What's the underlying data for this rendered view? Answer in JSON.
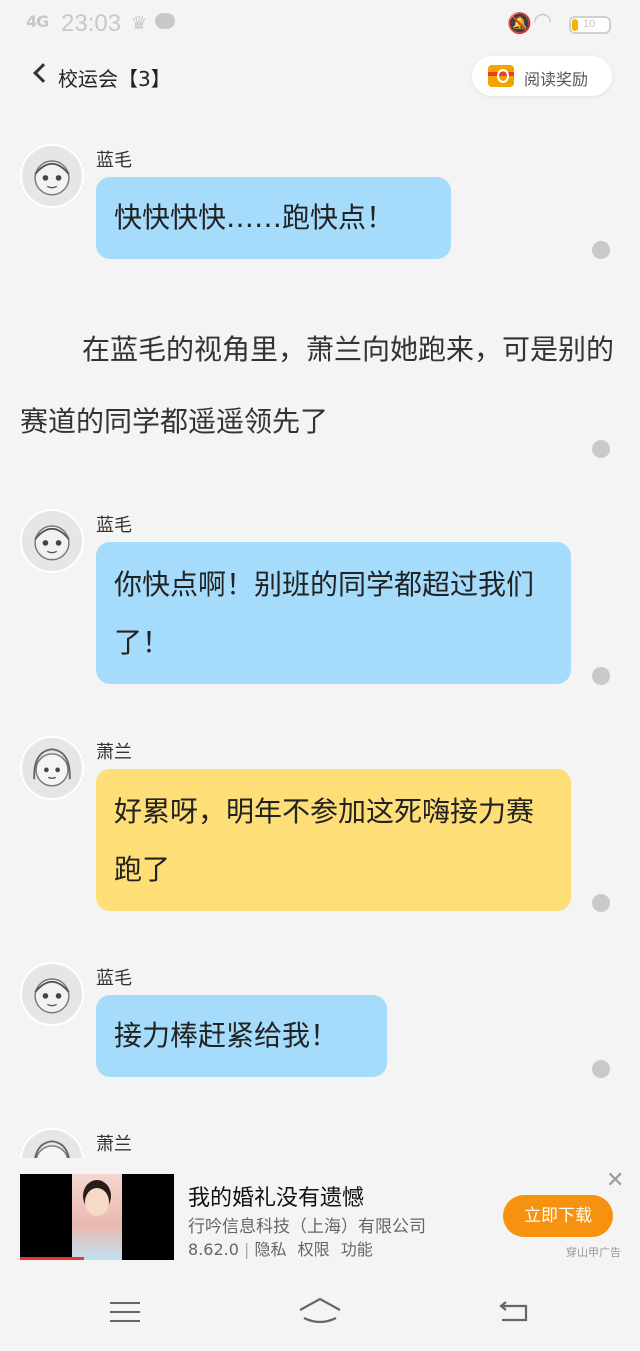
{
  "status_bar": {
    "signal": "4G",
    "time": "23:03",
    "battery": "10"
  },
  "header": {
    "back_label": "校运会【3】",
    "reward_label": "阅读奖励"
  },
  "messages": [
    {
      "speaker": "蓝毛",
      "text": "快快快快……跑快点！",
      "color": "blue"
    },
    {
      "narration": "在蓝毛的视角里，萧兰向她跑来，可是别的赛道的同学都遥遥领先了"
    },
    {
      "speaker": "蓝毛",
      "text": "你快点啊！别班的同学都超过我们了！",
      "color": "blue"
    },
    {
      "speaker": "萧兰",
      "text": "好累呀，明年不参加这死嗨接力赛跑了",
      "color": "yellow"
    },
    {
      "speaker": "蓝毛",
      "text": "接力棒赶紧给我！",
      "color": "blue"
    },
    {
      "speaker": "萧兰"
    }
  ],
  "ad": {
    "title": "我的婚礼没有遗憾",
    "company": "行吟信息科技（上海）有限公司",
    "version": "8.62.0",
    "links": [
      "隐私",
      "权限",
      "功能"
    ],
    "cta": "立即下载",
    "tag": "穿山甲广告",
    "close": "✕"
  },
  "colors": {
    "blue_bubble": "#a5dcfb",
    "yellow_bubble": "#fede77",
    "cta": "#f6920f"
  }
}
